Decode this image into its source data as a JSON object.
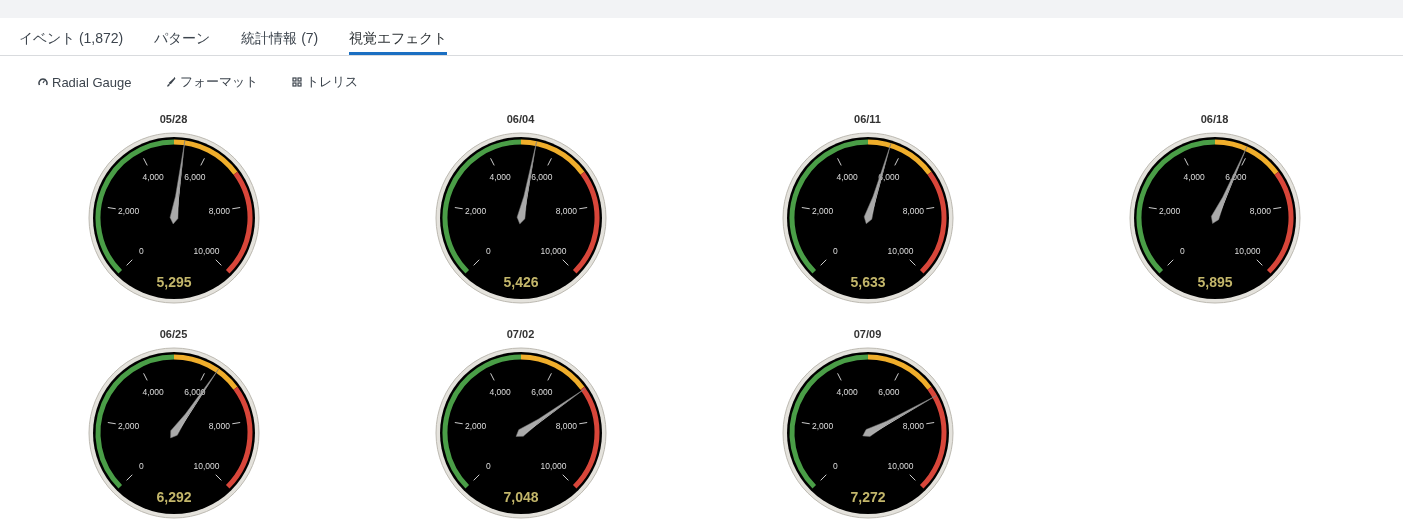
{
  "tabs": [
    {
      "label": "イベント (1,872)",
      "selected": false
    },
    {
      "label": "パターン",
      "selected": false
    },
    {
      "label": "統計情報 (7)",
      "selected": false
    },
    {
      "label": "視覚エフェクト",
      "selected": true
    }
  ],
  "toolbar": [
    {
      "kind": "gauge",
      "label": "Radial Gauge"
    },
    {
      "kind": "format",
      "label": "フォーマット"
    },
    {
      "kind": "trellis",
      "label": "トレリス"
    }
  ],
  "gauges": [
    {
      "title": "05/28",
      "value": "5,295",
      "level": 0.5295,
      "ticks": [
        "0",
        "2,000",
        "4,000",
        "6,000",
        "8,000",
        "10,000"
      ]
    },
    {
      "title": "06/04",
      "value": "5,426",
      "level": 0.5426,
      "ticks": [
        "0",
        "2,000",
        "4,000",
        "6,000",
        "8,000",
        "10,000"
      ]
    },
    {
      "title": "06/11",
      "value": "5,633",
      "level": 0.5633,
      "ticks": [
        "0",
        "2,000",
        "4,000",
        "6,000",
        "8,000",
        "10,000"
      ]
    },
    {
      "title": "06/18",
      "value": "5,895",
      "level": 0.5895,
      "ticks": [
        "0",
        "2,000",
        "4,000",
        "6,000",
        "8,000",
        "10,000"
      ]
    },
    {
      "title": "06/25",
      "value": "6,292",
      "level": 0.6292,
      "ticks": [
        "0",
        "2,000",
        "4,000",
        "6,000",
        "8,000",
        "10,000"
      ]
    },
    {
      "title": "07/02",
      "value": "7,048",
      "level": 0.7048,
      "ticks": [
        "0",
        "2,000",
        "4,000",
        "6,000",
        "8,000",
        "10,000"
      ]
    },
    {
      "title": "07/09",
      "value": "7,272",
      "level": 0.7272,
      "ticks": [
        "0",
        "2,000",
        "4,000",
        "6,000",
        "8,000",
        "10,000"
      ]
    }
  ]
}
